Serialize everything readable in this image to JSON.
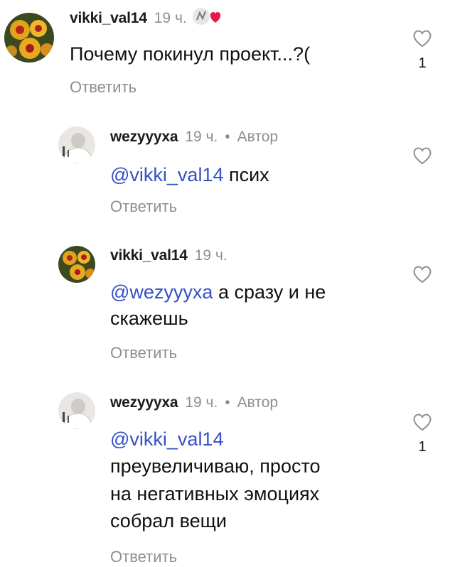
{
  "comments": [
    {
      "username": "vikki_val14",
      "time": "19 ч.",
      "text": "Почему покинул проект...?(",
      "reply": "Ответить",
      "likes": "1",
      "avatar": "flower-avatar"
    },
    {
      "username": "wezyyyxa",
      "time": "19 ч.",
      "author_label": "Автор",
      "mention": "@vikki_val14",
      "text": "псих",
      "reply": "Ответить",
      "likes": "",
      "avatar": "person-avatar"
    },
    {
      "username": "vikki_val14",
      "time": "19 ч.",
      "mention": "@wezyyyxa",
      "text_line1": "а сразу и не",
      "text_line2": "скажешь",
      "reply": "Ответить",
      "likes": "",
      "avatar": "flower-avatar"
    },
    {
      "username": "wezyyyxa",
      "time": "19 ч.",
      "author_label": "Автор",
      "mention": "@vikki_val14",
      "text_line1": "преувеличиваю, просто",
      "text_line2": "на негативных эмоциях",
      "text_line3": "собрал вещи",
      "reply": "Ответить",
      "likes": "1",
      "avatar": "person-avatar"
    }
  ],
  "colors": {
    "mention": "#3550c6",
    "muted": "#8e8e8e",
    "heart": "#e8174a"
  }
}
